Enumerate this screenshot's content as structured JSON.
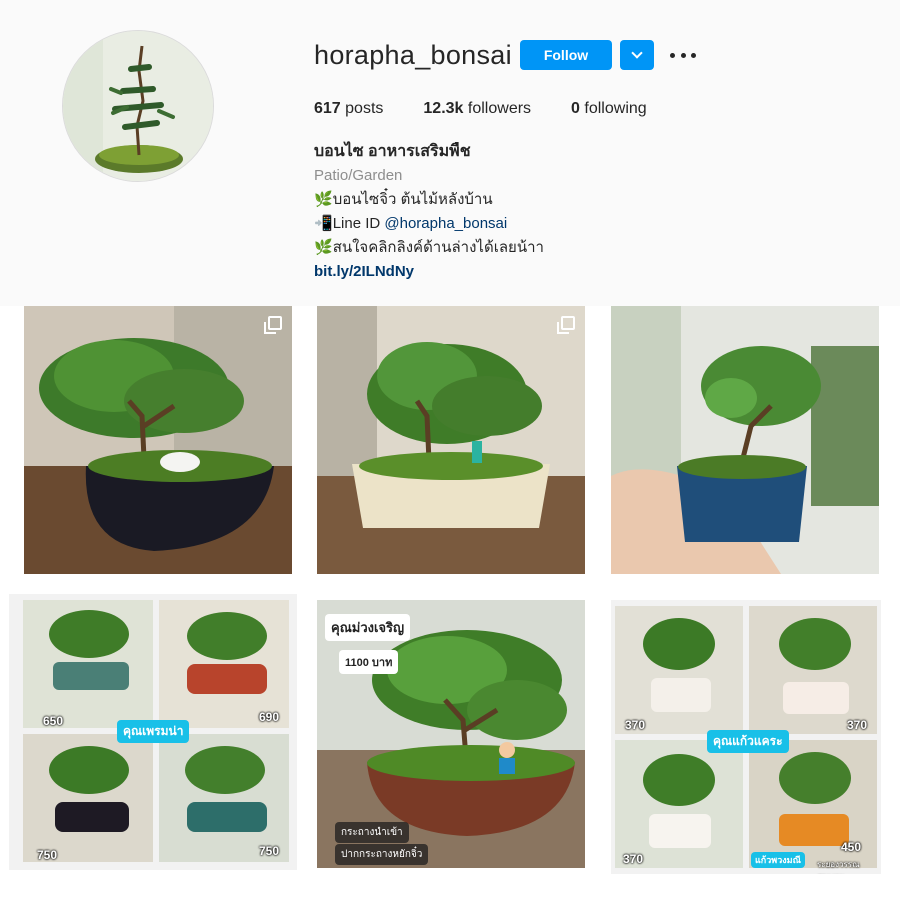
{
  "profile": {
    "username": "horapha_bonsai",
    "follow_label": "Follow",
    "stats": {
      "posts_count": "617",
      "posts_label": "posts",
      "followers_count": "12.3k",
      "followers_label": "followers",
      "following_count": "0",
      "following_label": "following"
    },
    "bio": {
      "full_name": "บอนไซ อาหารเสริมพืช",
      "category": "Patio/Garden",
      "line1_emoji": "🌿",
      "line1_text": "บอนไซจิ๋ว ต้นไม้หลังบ้าน",
      "line2_emoji": "📲",
      "line2_text": "Line ID ",
      "line2_mention": "@horapha_bonsai",
      "line3_emoji": "🌿",
      "line3_text": "สนใจคลิกลิงค์ด้านล่างได้เลยน้าา",
      "link": "bit.ly/2ILNdNy"
    }
  },
  "posts": [
    {
      "id": "post-1",
      "caption_overlays": []
    },
    {
      "id": "post-2",
      "caption_overlays": []
    },
    {
      "id": "post-3",
      "caption_overlays": []
    },
    {
      "id": "post-4",
      "prices": [
        "650",
        "690",
        "750",
        "750"
      ],
      "tag": "คุณเพรมน่า"
    },
    {
      "id": "post-5",
      "title": "คุณม่วงเจริญ",
      "price": "1100 บาท",
      "note1": "กระถางนำเข้า",
      "note2": "ปากกระถางหยักจิ๋ว"
    },
    {
      "id": "post-6",
      "prices": [
        "370",
        "370",
        "370",
        "450"
      ],
      "tag": "คุณแก้วแคระ",
      "note": "แก้วพวงมณี",
      "note2": "ระยองวรรณสวยงาม"
    }
  ],
  "colors": {
    "follow_blue": "#0095f6",
    "link_blue": "#00376b",
    "muted_grey": "#8e8e8e",
    "tag_cyan": "#18c0e8"
  }
}
